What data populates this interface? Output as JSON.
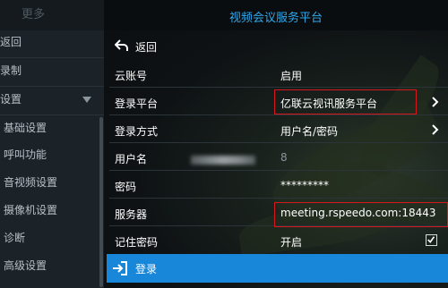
{
  "sidebar": {
    "title": "更多",
    "items": [
      {
        "label": "返回"
      },
      {
        "label": "录制"
      },
      {
        "label": "设置"
      },
      {
        "label": "基础设置"
      },
      {
        "label": "呼叫功能"
      },
      {
        "label": "音视频设置"
      },
      {
        "label": "摄像机设置"
      },
      {
        "label": "诊断"
      },
      {
        "label": "高级设置"
      }
    ]
  },
  "header": {
    "title": "视频会议服务平台"
  },
  "back": {
    "label": "返回"
  },
  "rows": [
    {
      "label": "云账号",
      "value": "启用"
    },
    {
      "label": "登录平台",
      "value": "亿联云视讯服务平台"
    },
    {
      "label": "登录方式",
      "value": "用户名/密码"
    },
    {
      "label": "用户名",
      "value": "8"
    },
    {
      "label": "密码",
      "value": "*********"
    },
    {
      "label": "服务器",
      "value": "meeting.rspeedo.com:18443"
    },
    {
      "label": "记住密码",
      "value": "开启"
    }
  ],
  "login": {
    "label": "登录"
  },
  "colors": {
    "accent": "#1886d9",
    "title": "#2fa7e8",
    "highlight": "#d4181e"
  }
}
